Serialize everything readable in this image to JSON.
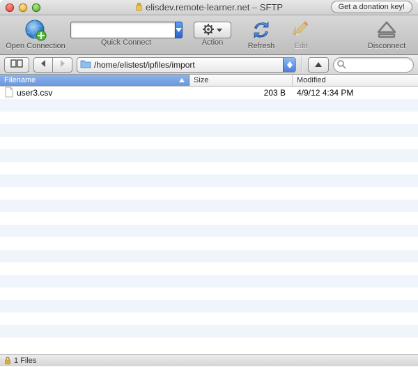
{
  "titlebar": {
    "title": "elisdev.remote-learner.net – SFTP",
    "donation_label": "Get a donation key!"
  },
  "toolbar": {
    "open_label": "Open Connection",
    "quick_label": "Quick Connect",
    "action_label": "Action",
    "refresh_label": "Refresh",
    "edit_label": "Edit",
    "disconnect_label": "Disconnect",
    "quick_value": ""
  },
  "path": {
    "current": "/home/elistest/ipfiles/import",
    "search_placeholder": ""
  },
  "columns": {
    "name": "Filename",
    "size": "Size",
    "modified": "Modified"
  },
  "files": [
    {
      "name": "user3.csv",
      "size": "203 B",
      "modified": "4/9/12 4:34 PM"
    }
  ],
  "status": {
    "text": "1 Files"
  }
}
